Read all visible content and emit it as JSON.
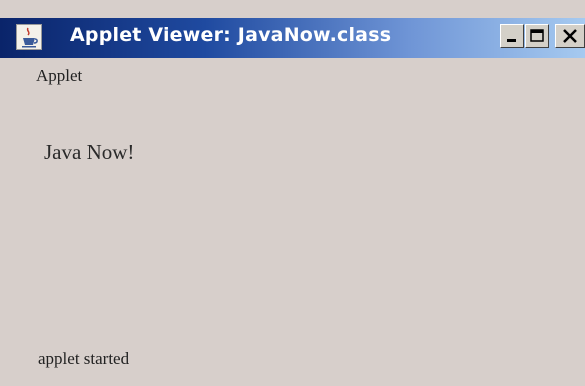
{
  "window": {
    "title": "Applet Viewer: JavaNow.class",
    "title_icon": "java-cup-icon",
    "controls": {
      "minimize_icon": "minimize-icon",
      "maximize_icon": "maximize-icon",
      "close_icon": "close-icon"
    }
  },
  "menu": {
    "items": [
      {
        "label": "Applet"
      }
    ]
  },
  "applet": {
    "text": "Java Now!"
  },
  "status": {
    "text": "applet started"
  },
  "colors": {
    "titlebar_start": "#0a246a",
    "titlebar_end": "#a6caf0",
    "window_background": "#d7cfcb"
  }
}
